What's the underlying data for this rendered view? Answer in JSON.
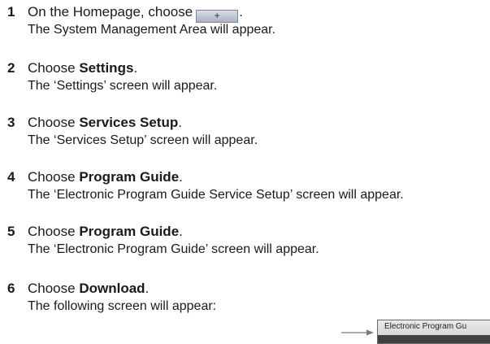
{
  "steps": [
    {
      "number": "1",
      "prefix": "On the Homepage, choose",
      "suffix": ".",
      "button_icon": "+",
      "result": "The System Management Area will appear."
    },
    {
      "number": "2",
      "prefix": "Choose",
      "bold": "Settings",
      "suffix": ".",
      "result": "The ‘Settings’ screen will appear."
    },
    {
      "number": "3",
      "prefix": "Choose",
      "bold": "Services Setup",
      "suffix": ".",
      "result": "The ‘Services Setup’ screen will appear."
    },
    {
      "number": "4",
      "prefix": "Choose",
      "bold": "Program Guide",
      "suffix": ".",
      "result": "The ‘Electronic Program Guide Service Setup’ screen will appear."
    },
    {
      "number": "5",
      "prefix": "Choose",
      "bold": "Program Guide",
      "suffix": ".",
      "result": "The ‘Electronic Program Guide’ screen will appear."
    },
    {
      "number": "6",
      "prefix": "Choose",
      "bold": "Download",
      "suffix": ".",
      "result": "The following screen will appear:"
    }
  ],
  "preview": {
    "title": "Electronic Program Gu",
    "arrow_icon": "right-arrow-icon"
  }
}
